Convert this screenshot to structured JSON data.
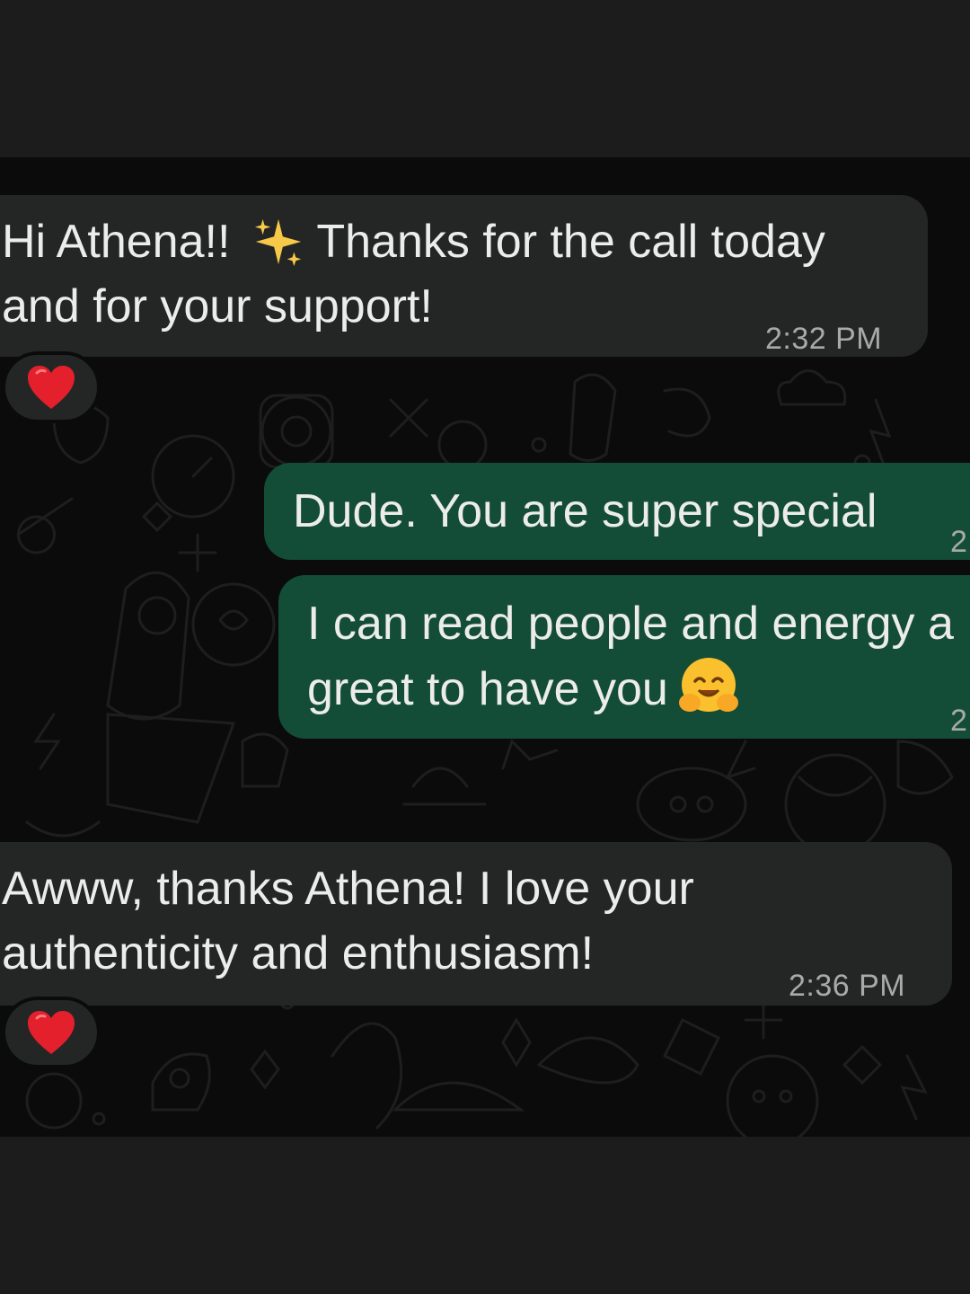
{
  "messages": [
    {
      "direction": "incoming",
      "line1_pre": "Hi Athena!! ",
      "emoji": "sparkles",
      "line1_post": " Thanks for the call today",
      "line2": "and for your support!",
      "time": "2:32 PM",
      "reaction": "red-heart"
    },
    {
      "direction": "outgoing",
      "line1": "Dude. You are super special",
      "time_partial": "2"
    },
    {
      "direction": "outgoing",
      "line1": "I can read people and energy a",
      "line2": "great to have you",
      "emoji": "hugging-face",
      "time_partial": "2"
    },
    {
      "direction": "incoming",
      "line1": "Awww, thanks Athena! I love your",
      "line2": "authenticity and enthusiasm!",
      "time": "2:36 PM",
      "reaction": "red-heart"
    }
  ],
  "colors": {
    "incoming_bubble": "#242626",
    "outgoing_bubble": "#144d37",
    "background": "#0b0b0b",
    "timestamp": "#a8aaa9"
  }
}
